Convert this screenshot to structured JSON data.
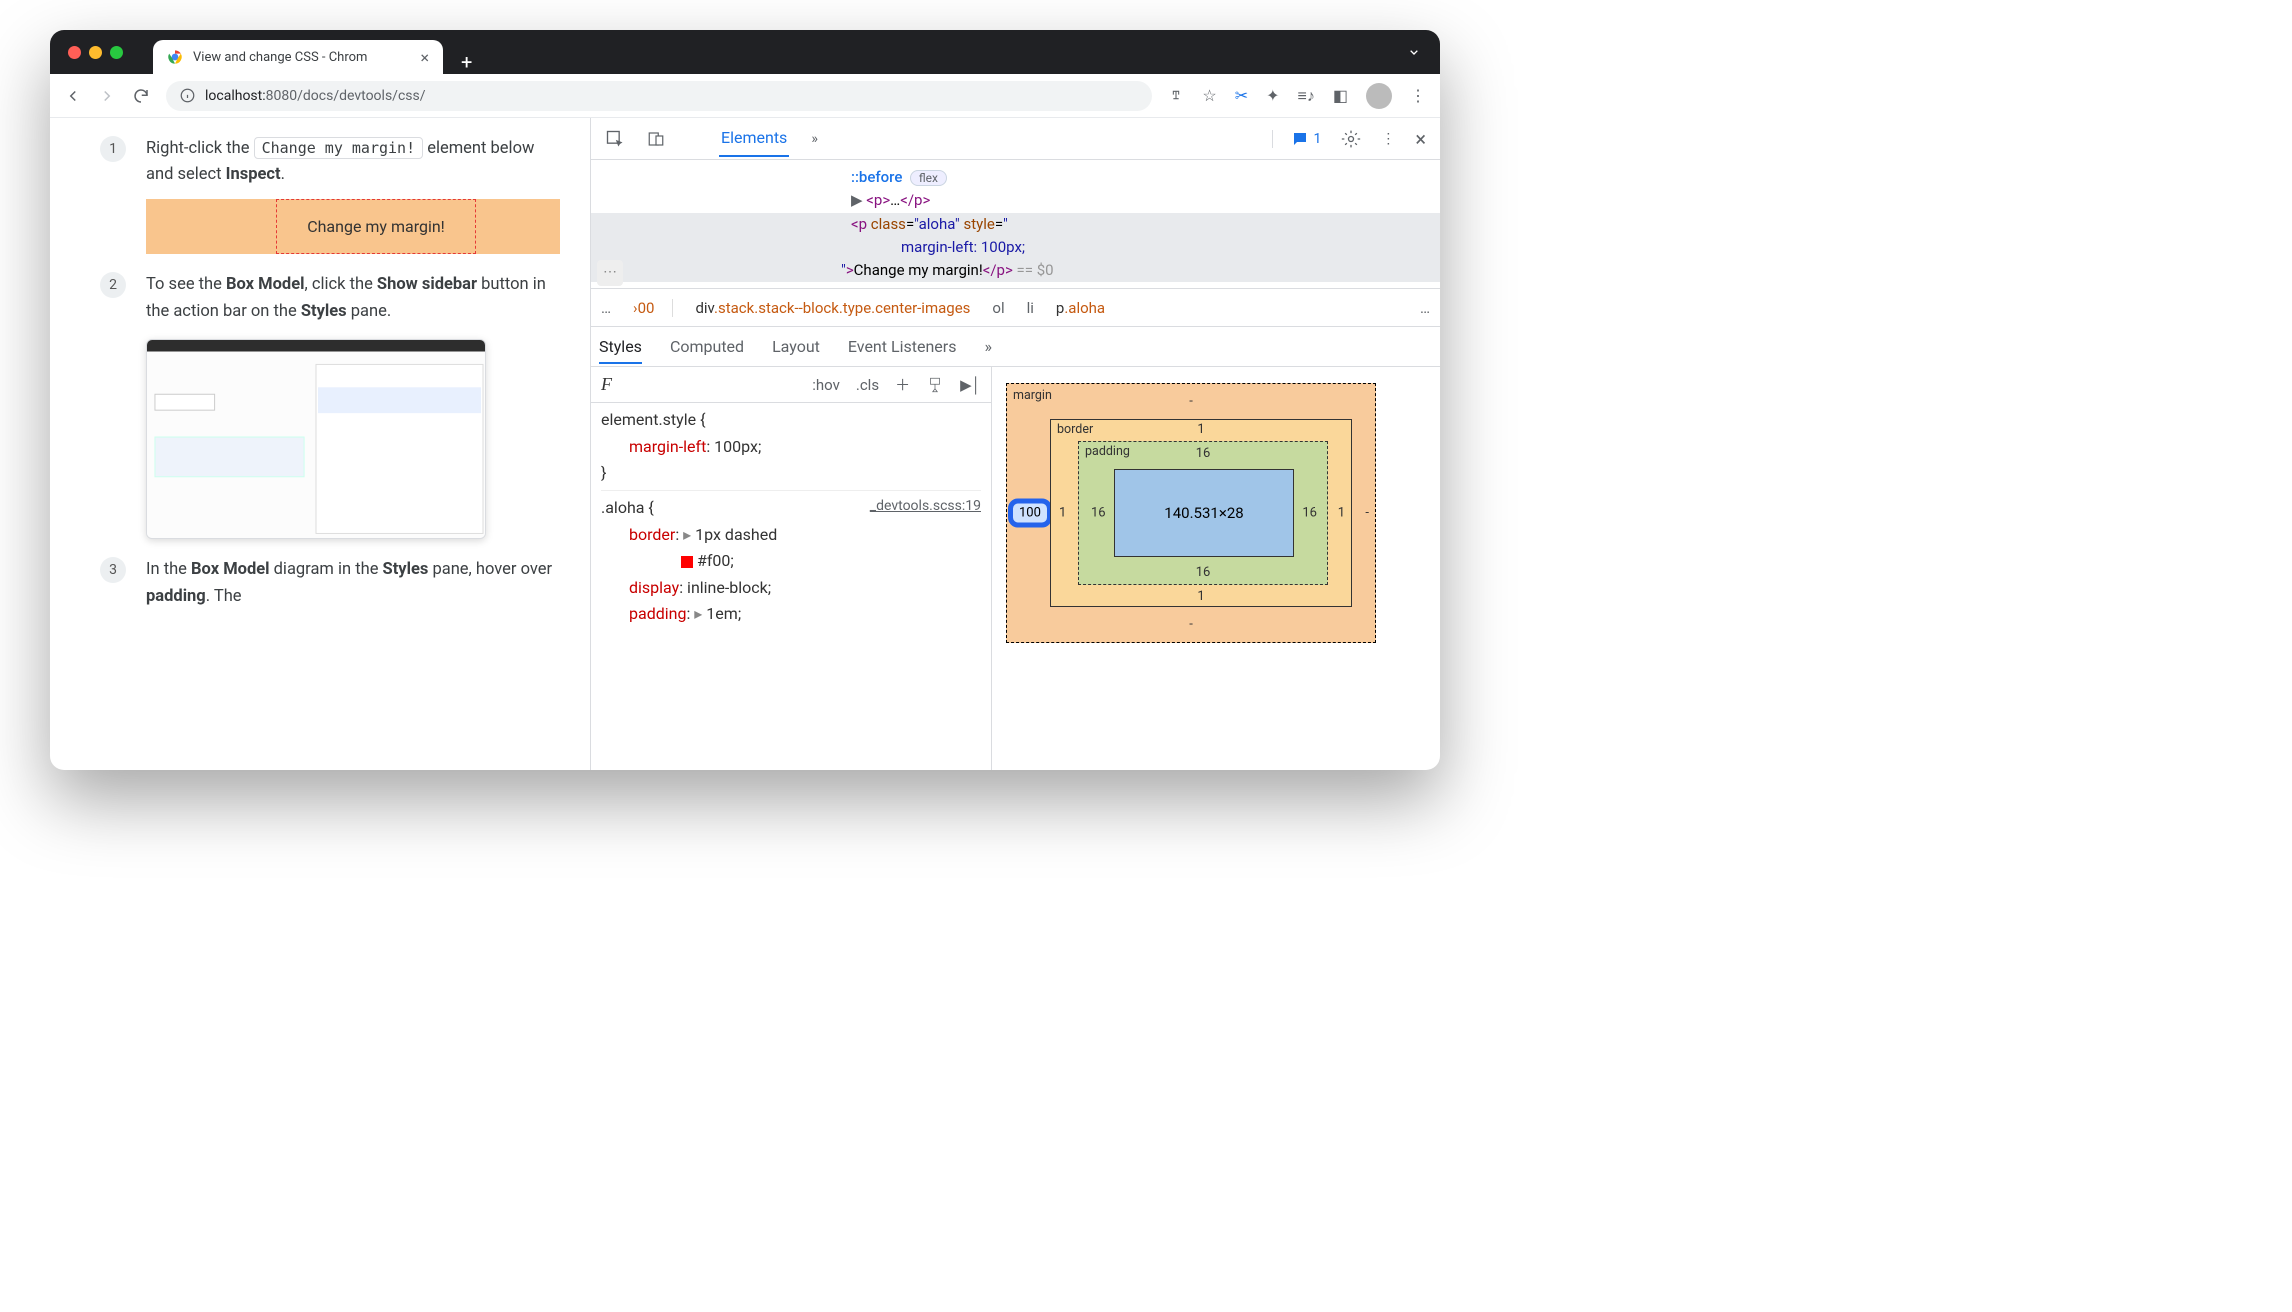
{
  "window": {
    "tab_title": "View and change CSS - Chrom",
    "url_host": "localhost:",
    "url_port": "8080",
    "url_path": "/docs/devtools/css/"
  },
  "docs": {
    "steps": [
      {
        "num": "1",
        "pre": "Right-click the ",
        "code": "Change my margin!",
        "post": " element below and select ",
        "bold": "Inspect",
        "tail": "."
      },
      {
        "num": "2",
        "pre": "To see the ",
        "b1": "Box Model",
        "mid": ", click the ",
        "b2": "Show sidebar",
        "post": " button in the action bar on the ",
        "b3": "Styles",
        "tail2": " pane."
      },
      {
        "num": "3",
        "pre3": "In the ",
        "b4": "Box Model",
        "mid3": " diagram in the ",
        "b5": "Styles",
        "post3": " pane, hover over ",
        "b6": "padding",
        "tail3": ". The"
      }
    ],
    "demo_text": "Change my margin!"
  },
  "devtools": {
    "tabs": {
      "elements": "Elements"
    },
    "issues_count": "1",
    "dom": {
      "before": "::before",
      "flex_badge": "flex",
      "p_collapsed": "…",
      "sel_tag_open": "<p ",
      "sel_class_attr": "class",
      "sel_class_val": "\"aloha\"",
      "sel_style_attr": "style",
      "sel_style_val1": "margin-left: 100px;",
      "sel_text": "Change my margin!",
      "sel_tag_close": "</p>",
      "sel_eq": " == $0"
    },
    "breadcrumb": {
      "lead": "…",
      "n1": "00",
      "n2": "div.stack.stack--block.type.center-images",
      "n3": "ol",
      "n4": "li",
      "n5": "p.aloha",
      "trail": "…"
    },
    "styles_tabs": {
      "styles": "Styles",
      "computed": "Computed",
      "layout": "Layout",
      "listeners": "Event Listeners"
    },
    "filter": {
      "hov": ":hov",
      "cls": ".cls"
    },
    "rules": {
      "block1_sel": "element.style {",
      "block1_prop": "margin-left",
      "block1_val": "100px",
      "block2_sel": ".aloha {",
      "block2_src": "_devtools.scss:19",
      "p_border": "border",
      "v_border": "1px dashed",
      "v_border2": "#f00",
      "p_display": "display",
      "v_display": "inline-block",
      "p_padding": "padding",
      "v_padding": "1em"
    },
    "box": {
      "margin_label": "margin",
      "border_label": "border",
      "padding_label": "padding",
      "content": "140.531×28",
      "margin_top": "-",
      "margin_right": "-",
      "margin_bottom": "-",
      "margin_left": "100",
      "border_all": "1",
      "padding_all": "16"
    }
  }
}
